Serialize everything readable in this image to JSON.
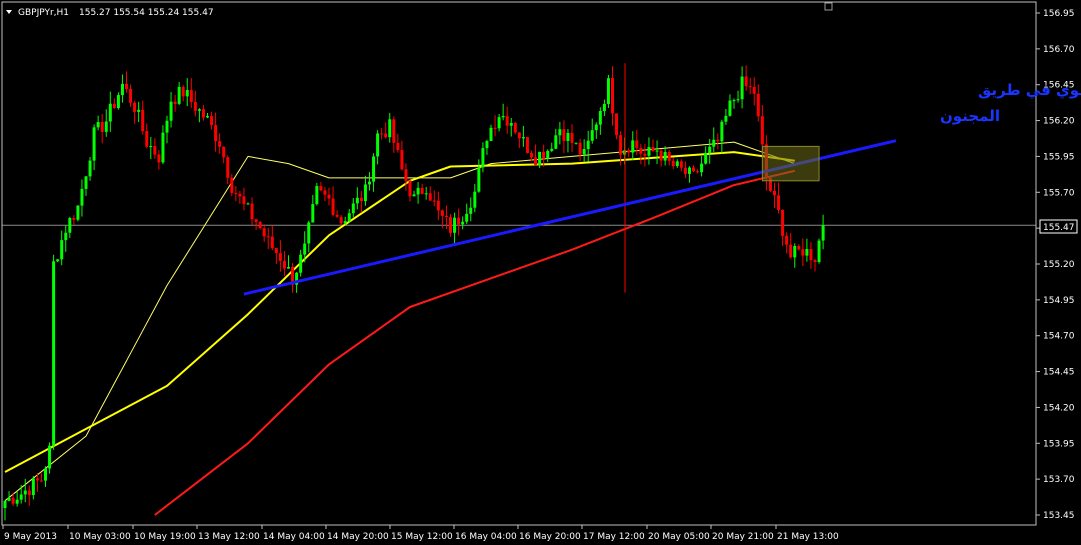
{
  "header": {
    "symbol": "GBPJPYr,H1",
    "ohlc": "155.27 155.54 155.24 155.47",
    "dropdown_icon": "triangle-down-icon"
  },
  "price_tag": "155.47",
  "annotation": {
    "line1": "كلاستر قوي في طريق",
    "line2": "المجنون"
  },
  "colors": {
    "background": "#000000",
    "bull": "#00ff00",
    "bear": "#ff0000",
    "ma_fast": "#ffff00",
    "ma_slow": "#ff1a1a",
    "ma_thin": "#ffff66",
    "trendline": "#1a1aff",
    "box": "#6b6b1a"
  },
  "chart_data": {
    "type": "candlestick",
    "symbol": "GBPJPYr",
    "timeframe": "H1",
    "ylim": [
      153.4,
      157.05
    ],
    "y_ticks": [
      156.95,
      156.7,
      156.45,
      156.2,
      155.95,
      155.7,
      155.45,
      155.2,
      154.95,
      154.7,
      154.45,
      154.2,
      153.95,
      153.7,
      153.45
    ],
    "x_tick_labels": [
      "9 May 2013",
      "10 May 03:00",
      "10 May 19:00",
      "13 May 12:00",
      "14 May 04:00",
      "14 May 20:00",
      "15 May 12:00",
      "16 May 04:00",
      "16 May 20:00",
      "17 May 12:00",
      "20 May 05:00",
      "20 May 21:00",
      "21 May 13:00"
    ],
    "last_price": 155.47,
    "bar_count": 203,
    "ohlc_keypoints": [
      [
        0,
        153.55
      ],
      [
        4,
        153.6
      ],
      [
        9,
        153.7
      ],
      [
        11,
        153.9
      ],
      [
        12,
        155.2
      ],
      [
        15,
        155.45
      ],
      [
        18,
        155.6
      ],
      [
        22,
        156.1
      ],
      [
        25,
        156.2
      ],
      [
        29,
        156.45
      ],
      [
        32,
        156.3
      ],
      [
        35,
        156.05
      ],
      [
        38,
        155.95
      ],
      [
        41,
        156.35
      ],
      [
        44,
        156.4
      ],
      [
        47,
        156.3
      ],
      [
        50,
        156.2
      ],
      [
        53,
        156.05
      ],
      [
        56,
        155.75
      ],
      [
        59,
        155.6
      ],
      [
        62,
        155.5
      ],
      [
        65,
        155.35
      ],
      [
        68,
        155.25
      ],
      [
        71,
        155.1
      ],
      [
        74,
        155.3
      ],
      [
        77,
        155.7
      ],
      [
        80,
        155.65
      ],
      [
        83,
        155.5
      ],
      [
        86,
        155.6
      ],
      [
        89,
        155.7
      ],
      [
        92,
        156.1
      ],
      [
        95,
        156.15
      ],
      [
        98,
        155.85
      ],
      [
        101,
        155.65
      ],
      [
        104,
        155.75
      ],
      [
        107,
        155.55
      ],
      [
        110,
        155.45
      ],
      [
        113,
        155.55
      ],
      [
        116,
        155.7
      ],
      [
        119,
        156.1
      ],
      [
        122,
        156.25
      ],
      [
        125,
        156.2
      ],
      [
        128,
        156.05
      ],
      [
        131,
        155.95
      ],
      [
        134,
        156.0
      ],
      [
        137,
        156.15
      ],
      [
        140,
        156.05
      ],
      [
        143,
        155.95
      ],
      [
        146,
        156.2
      ],
      [
        149,
        156.45
      ],
      [
        152,
        156.0
      ],
      [
        155,
        156.05
      ],
      [
        158,
        155.95
      ],
      [
        161,
        156.0
      ],
      [
        164,
        155.9
      ],
      [
        167,
        155.85
      ],
      [
        170,
        155.8
      ],
      [
        173,
        155.95
      ],
      [
        176,
        156.05
      ],
      [
        179,
        156.3
      ],
      [
        182,
        156.45
      ],
      [
        185,
        156.4
      ],
      [
        188,
        155.8
      ],
      [
        191,
        155.55
      ],
      [
        194,
        155.25
      ],
      [
        197,
        155.3
      ],
      [
        200,
        155.25
      ],
      [
        202,
        155.47
      ]
    ],
    "ma_fast": [
      [
        0,
        153.75
      ],
      [
        20,
        154.05
      ],
      [
        40,
        154.35
      ],
      [
        60,
        154.85
      ],
      [
        80,
        155.4
      ],
      [
        100,
        155.78
      ],
      [
        110,
        155.88
      ],
      [
        140,
        155.9
      ],
      [
        180,
        155.98
      ],
      [
        195,
        155.92
      ]
    ],
    "ma_slow": [
      [
        37,
        153.45
      ],
      [
        60,
        153.95
      ],
      [
        80,
        154.5
      ],
      [
        100,
        154.9
      ],
      [
        120,
        155.1
      ],
      [
        140,
        155.3
      ],
      [
        160,
        155.52
      ],
      [
        180,
        155.75
      ],
      [
        195,
        155.85
      ]
    ],
    "ma_thin": [
      [
        0,
        153.55
      ],
      [
        20,
        154.0
      ],
      [
        40,
        155.05
      ],
      [
        60,
        155.95
      ],
      [
        70,
        155.9
      ],
      [
        80,
        155.8
      ],
      [
        95,
        155.8
      ],
      [
        110,
        155.8
      ],
      [
        120,
        155.9
      ],
      [
        140,
        155.95
      ],
      [
        160,
        156.0
      ],
      [
        180,
        156.05
      ],
      [
        195,
        155.9
      ]
    ],
    "trendline": {
      "start_bar": 59,
      "start_price": 154.99,
      "end_bar": 220,
      "end_price": 156.06
    },
    "box": {
      "bar_start": 187,
      "bar_end": 201,
      "price_top": 156.02,
      "price_bottom": 155.78
    }
  }
}
